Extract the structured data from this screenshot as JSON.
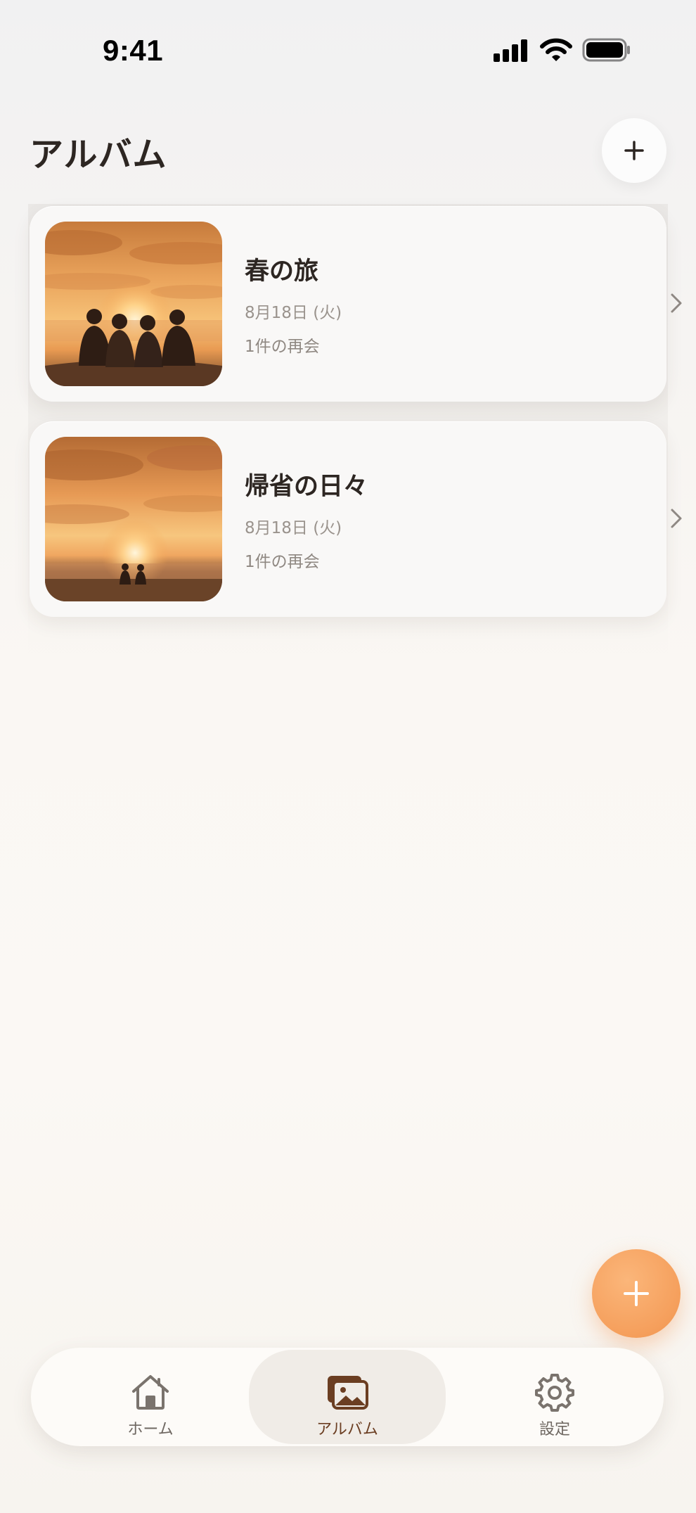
{
  "status_bar": {
    "time": "9:41"
  },
  "header": {
    "title": "アルバム"
  },
  "albums": [
    {
      "title": "春の旅",
      "date": "8月18日 (火)",
      "count": "1件の再会",
      "photo": "four-people-sunset"
    },
    {
      "title": "帰省の日々",
      "date": "8月18日 (火)",
      "count": "1件の再会",
      "photo": "two-people-beach-sunset"
    }
  ],
  "tab_bar": {
    "tabs": [
      {
        "label": "ホーム",
        "icon": "house-icon",
        "active": false
      },
      {
        "label": "アルバム",
        "icon": "photos-icon",
        "active": true
      },
      {
        "label": "設定",
        "icon": "gear-icon",
        "active": false
      }
    ]
  },
  "colors": {
    "accent": "#f59f5c",
    "title_text": "#2d2622",
    "secondary_text": "#9a938d",
    "active_tab_text": "#6b3e22"
  }
}
